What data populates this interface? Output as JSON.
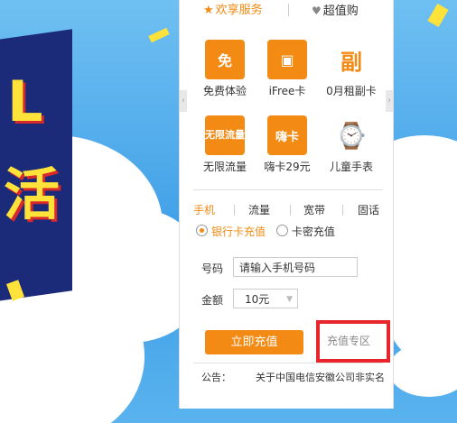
{
  "tabs": {
    "share": "欢享服务",
    "deal": "超值购"
  },
  "banner": {
    "char1": "L",
    "char2": "活"
  },
  "services": [
    {
      "icon": "免",
      "label": "免费体验"
    },
    {
      "icon": "▣",
      "label": "iFree卡"
    },
    {
      "icon": "副",
      "label": "0月租副卡"
    },
    {
      "icon": "无限流量",
      "label": "无限流量"
    },
    {
      "icon": "嗨卡",
      "label": "嗨卡29元"
    },
    {
      "icon": "⌚",
      "label": "儿童手表"
    }
  ],
  "recharge_tabs": [
    "手机",
    "流量",
    "宽带",
    "固话"
  ],
  "radio": {
    "bank": "银行卡充值",
    "card": "卡密充值"
  },
  "form": {
    "number_label": "号码",
    "number_placeholder": "请输入手机号码",
    "amount_label": "金额",
    "amount_value": "10元"
  },
  "buttons": {
    "recharge": "立即充值",
    "zone": "充值专区"
  },
  "notice": {
    "label": "公告：",
    "text": "关于中国电信安徽公司非实名"
  },
  "colors": {
    "accent": "#f28a13",
    "highlight": "#e8242c"
  }
}
